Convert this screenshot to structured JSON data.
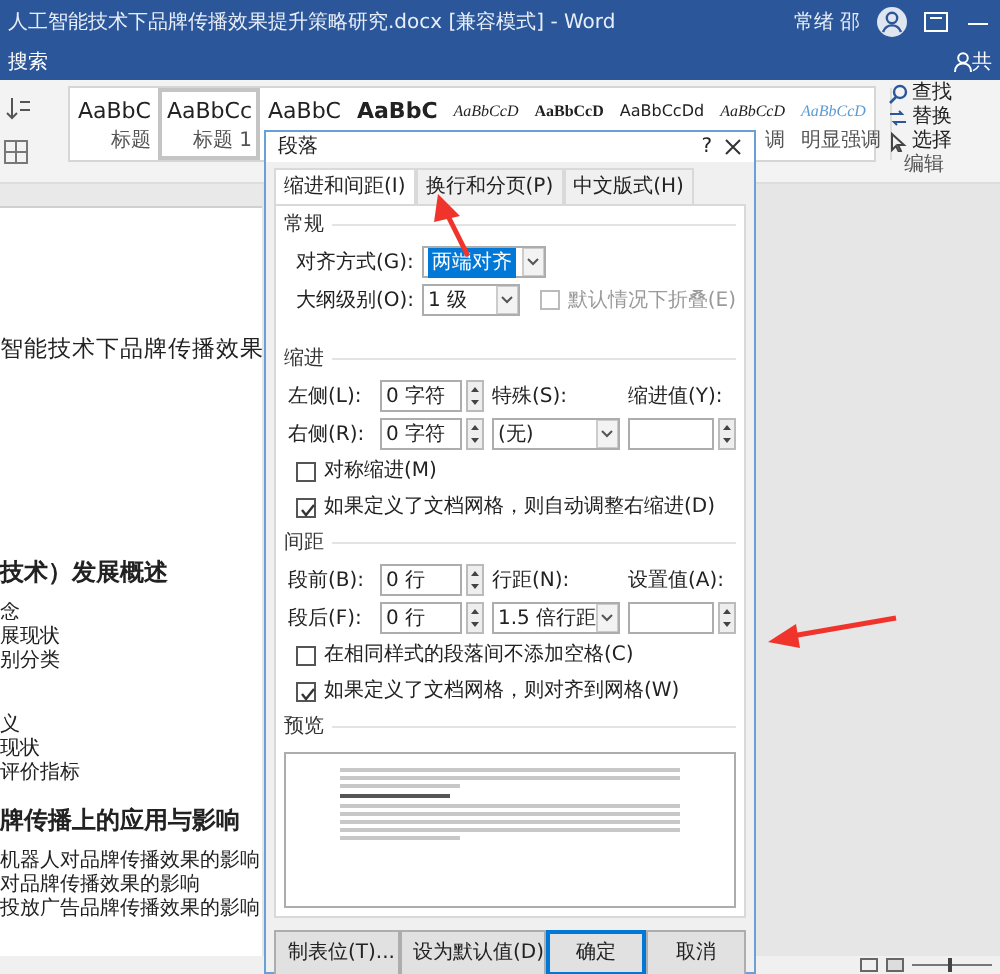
{
  "window": {
    "title": "人工智能技术下品牌传播效果提升策略研究.docx [兼容模式] - Word",
    "user": "常绪 邵",
    "tell_me": "搜索",
    "share": "共"
  },
  "ribbon": {
    "styles": [
      {
        "sample": "AaBbC",
        "label": "标题",
        "kind": "large",
        "selected": false
      },
      {
        "sample": "AaBbCc",
        "label": "标题 1",
        "kind": "large",
        "selected": true
      },
      {
        "sample": "AaBbC",
        "kind": "large",
        "selected": false
      },
      {
        "sample": "AaBbC",
        "kind": "bold",
        "selected": false
      },
      {
        "sample": "AaBbCcD",
        "kind": "italic",
        "selected": false
      },
      {
        "sample": "AaBbCcD",
        "kind": "serif-bold",
        "selected": false
      },
      {
        "sample": "AaBbCcDd",
        "kind": "small",
        "selected": false
      },
      {
        "sample": "AaBbCcD",
        "label": "调",
        "kind": "italic",
        "selected": false
      },
      {
        "sample": "AaBbCcD",
        "label": "明显强调",
        "kind": "accent",
        "selected": false
      }
    ],
    "editing": [
      {
        "label": "查找",
        "kind": "find"
      },
      {
        "label": "替换",
        "kind": "replace"
      },
      {
        "label": "选择",
        "kind": "select"
      }
    ],
    "editing_group": "编辑"
  },
  "document": {
    "lines": [
      {
        "kind": "title",
        "text": "智能技术下品牌传播效果"
      },
      {
        "kind": "heading",
        "text": "技术）发展概述"
      },
      {
        "kind": "item",
        "text": "念"
      },
      {
        "kind": "item",
        "text": "展现状"
      },
      {
        "kind": "item",
        "text": "别分类"
      },
      {
        "kind": "gap"
      },
      {
        "kind": "item",
        "text": "义"
      },
      {
        "kind": "item",
        "text": "现状"
      },
      {
        "kind": "item",
        "text": "评价指标"
      },
      {
        "kind": "heading",
        "text": "牌传播上的应用与影响"
      },
      {
        "kind": "item",
        "text": "机器人对品牌传播效果的影响"
      },
      {
        "kind": "item",
        "text": "对品牌传播效果的影响"
      },
      {
        "kind": "item",
        "text": "投放广告品牌传播效果的影响"
      }
    ]
  },
  "dialog": {
    "title": "段落",
    "help": "?",
    "tabs": [
      {
        "label": "缩进和间距(I)",
        "selected": true
      },
      {
        "label": "换行和分页(P)",
        "selected": false
      },
      {
        "label": "中文版式(H)",
        "selected": false
      }
    ],
    "general": {
      "heading": "常规",
      "alignment": {
        "label": "对齐方式(G):",
        "value": "两端对齐"
      },
      "outline": {
        "label": "大纲级别(O):",
        "value": "1 级"
      },
      "collapse": {
        "label": "默认情况下折叠(E)",
        "checked": false,
        "disabled": true
      }
    },
    "indent": {
      "heading": "缩进",
      "left": {
        "label": "左侧(L):",
        "value": "0 字符"
      },
      "right": {
        "label": "右侧(R):",
        "value": "0 字符"
      },
      "special": {
        "label": "特殊(S):",
        "value": "(无)"
      },
      "by": {
        "label": "缩进值(Y):"
      },
      "checks": [
        {
          "label": "对称缩进(M)",
          "checked": false
        },
        {
          "label": "如果定义了文档网格，则自动调整右缩进(D)",
          "checked": true
        }
      ]
    },
    "spacing": {
      "heading": "间距",
      "before": {
        "label": "段前(B):",
        "value": "0 行"
      },
      "after": {
        "label": "段后(F):",
        "value": "0 行"
      },
      "line": {
        "label": "行距(N):",
        "value": "1.5 倍行距"
      },
      "at": {
        "label": "设置值(A):"
      },
      "checks": [
        {
          "label": "在相同样式的段落间不添加空格(C)",
          "checked": false
        },
        {
          "label": "如果定义了文档网格，则对齐到网格(W)",
          "checked": true
        }
      ]
    },
    "preview": {
      "heading": "预览"
    },
    "buttons": [
      {
        "label": "制表位(T)...",
        "default": false
      },
      {
        "label": "设为默认值(D)",
        "default": false
      },
      {
        "label": "确定",
        "default": true
      },
      {
        "label": "取消",
        "default": false
      }
    ]
  }
}
